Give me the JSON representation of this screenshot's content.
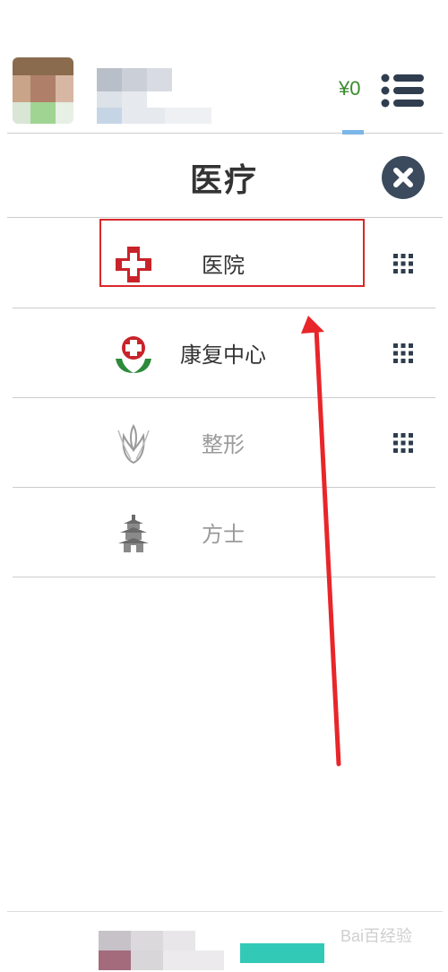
{
  "header": {
    "balance": "¥0",
    "menu_icon": "list-menu-icon"
  },
  "title_bar": {
    "title": "医疗",
    "close_icon": "close-icon"
  },
  "list": {
    "items": [
      {
        "label": "医院",
        "icon": "red-cross-icon",
        "has_grid": true,
        "style": "dark"
      },
      {
        "label": "康复中心",
        "icon": "rehab-cross-icon",
        "has_grid": true,
        "style": "dark"
      },
      {
        "label": "整形",
        "icon": "tulip-icon",
        "has_grid": true,
        "style": "gray"
      },
      {
        "label": "方士",
        "icon": "pagoda-icon",
        "has_grid": false,
        "style": "gray"
      }
    ]
  },
  "annotation": {
    "highlight_color": "#d8282c",
    "arrow_color": "#e8262a"
  },
  "colors": {
    "balance_green": "#3a8a2e",
    "close_button": "#3b4a5c",
    "menu_icon": "#2f3d4f"
  },
  "footer": {
    "watermark": "Bai百经验"
  }
}
